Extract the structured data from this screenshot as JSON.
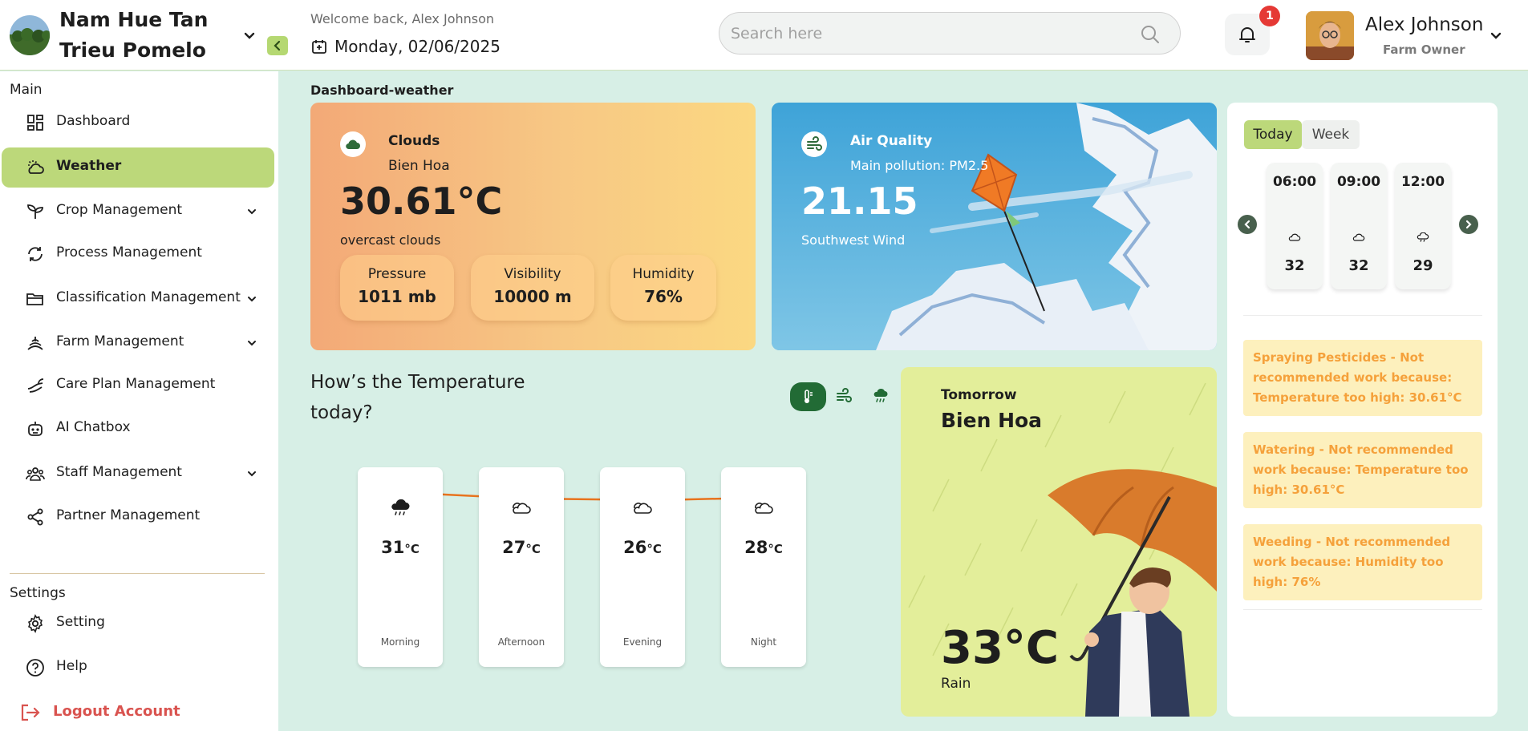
{
  "header": {
    "farm_name": "Nam Hue Tan Trieu Pomelo",
    "welcome": "Welcome back, Alex Johnson",
    "date": "Monday, 02/06/2025",
    "search_placeholder": "Search here",
    "notification_count": "1",
    "user_name": "Alex Johnson",
    "user_role": "Farm Owner"
  },
  "sidebar": {
    "main_label": "Main",
    "settings_label": "Settings",
    "items": [
      {
        "label": "Dashboard",
        "icon": "dashboard-icon"
      },
      {
        "label": "Weather",
        "icon": "weather-icon",
        "active": true
      },
      {
        "label": "Crop Management",
        "icon": "sprout-icon",
        "has_submenu": true
      },
      {
        "label": "Process Management",
        "icon": "cycle-icon"
      },
      {
        "label": "Classification Management",
        "icon": "folder-icon",
        "has_submenu": true
      },
      {
        "label": "Farm Management",
        "icon": "farm-icon",
        "has_submenu": true
      },
      {
        "label": "Care Plan Management",
        "icon": "leaf-hand-icon"
      },
      {
        "label": "AI Chatbox",
        "icon": "robot-icon"
      },
      {
        "label": "Staff Management",
        "icon": "staff-icon",
        "has_submenu": true
      },
      {
        "label": "Partner Management",
        "icon": "share-icon"
      }
    ],
    "settings_items": [
      {
        "label": "Setting",
        "icon": "gear-icon"
      },
      {
        "label": "Help",
        "icon": "help-icon"
      }
    ],
    "logout": "Logout Account"
  },
  "main": {
    "page_title": "Dashboard-weather",
    "clouds": {
      "title": "Clouds",
      "city": "Bien Hoa",
      "temperature": "30.61°C",
      "description": "overcast clouds",
      "stats": [
        {
          "label": "Pressure",
          "value": "1011 mb"
        },
        {
          "label": "Visibility",
          "value": "10000 m"
        },
        {
          "label": "Humidity",
          "value": "76%"
        }
      ]
    },
    "air": {
      "title": "Air Quality",
      "pollution": "Main pollution: PM2.5",
      "value": "21.15",
      "wind": "Southwest Wind"
    },
    "temperature_today": {
      "heading": "How’s the Temperature today?",
      "periods": [
        {
          "label": "Morning",
          "value": "31",
          "unit": "°C",
          "icon": "cloud-rain-icon"
        },
        {
          "label": "Afternoon",
          "value": "27",
          "unit": "°C",
          "icon": "cloud-sun-icon"
        },
        {
          "label": "Evening",
          "value": "26",
          "unit": "°C",
          "icon": "cloud-sun-icon"
        },
        {
          "label": "Night",
          "value": "28",
          "unit": "°C",
          "icon": "cloud-sun-icon"
        }
      ],
      "line_color": "#e8731e"
    },
    "tomorrow": {
      "label": "Tomorrow",
      "city": "Bien Hoa",
      "temperature": "33°C",
      "description": "Rain"
    }
  },
  "forecast_panel": {
    "tabs": [
      "Today",
      "Week"
    ],
    "active_tab": "Today",
    "hours": [
      {
        "time": "06:00",
        "value": "32",
        "icon": "cloud-icon"
      },
      {
        "time": "09:00",
        "value": "32",
        "icon": "cloud-icon"
      },
      {
        "time": "12:00",
        "value": "29",
        "icon": "cloud-rain-icon"
      }
    ],
    "warnings": [
      "Spraying Pesticides - Not recommended work because: Temperature too high: 30.61°C",
      "Watering - Not recommended work because: Temperature too high: 30.61°C",
      "Weeding - Not recommended work because: Humidity too high: 76%"
    ]
  },
  "colors": {
    "accent_green": "#bcd87a",
    "dark_green": "#226b35",
    "warning_text": "#f5a13b",
    "warning_bg": "#fdf0bd",
    "logout_red": "#d9534f"
  }
}
